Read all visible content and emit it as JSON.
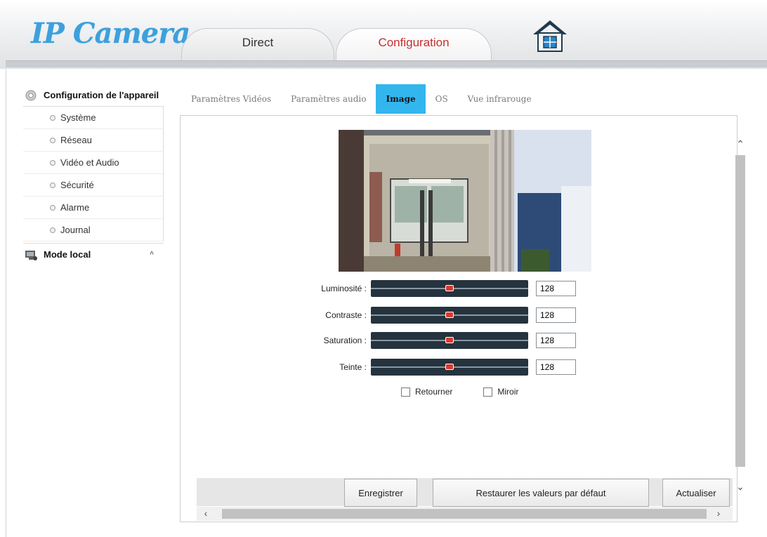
{
  "header": {
    "logo_text": "IP Camera",
    "tabs": [
      {
        "label": "Direct",
        "active": false
      },
      {
        "label": "Configuration",
        "active": true
      }
    ],
    "home_icon": "home-icon",
    "active_tab_color": "#c5302e"
  },
  "sidebar": {
    "device_config": {
      "label": "Configuration de l'appareil",
      "icon": "gear-icon",
      "items": [
        {
          "label": "Système"
        },
        {
          "label": "Réseau"
        },
        {
          "label": "Vidéo et Audio"
        },
        {
          "label": "Sécurité"
        },
        {
          "label": "Alarme"
        },
        {
          "label": "Journal"
        }
      ]
    },
    "local_mode": {
      "label": "Mode local",
      "icon": "monitor-icon",
      "caret": "^"
    }
  },
  "subtabs": [
    {
      "label": "Paramètres Vidéos",
      "active": false
    },
    {
      "label": "Paramètres audio",
      "active": false
    },
    {
      "label": "Image",
      "active": true
    },
    {
      "label": "OS",
      "active": false
    },
    {
      "label": "Vue infrarouge",
      "active": false
    }
  ],
  "image_settings": {
    "sliders": [
      {
        "label": "Luminosité :",
        "value": "128",
        "level": 0.5
      },
      {
        "label": "Contraste :",
        "value": "128",
        "level": 0.5
      },
      {
        "label": "Saturation :",
        "value": "128",
        "level": 0.5
      },
      {
        "label": "Teinte :",
        "value": "128",
        "level": 0.5
      }
    ],
    "checkboxes": [
      {
        "label": "Retourner",
        "checked": false
      },
      {
        "label": "Miroir",
        "checked": false
      }
    ]
  },
  "buttons": {
    "save": "Enregistrer",
    "restore": "Restaurer les valeurs par défaut",
    "refresh": "Actualiser"
  },
  "colors": {
    "accent": "#33b6ee",
    "slider_bg": "#24333e",
    "slider_thumb": "#d63a2f",
    "logo": "#3da0dd"
  }
}
